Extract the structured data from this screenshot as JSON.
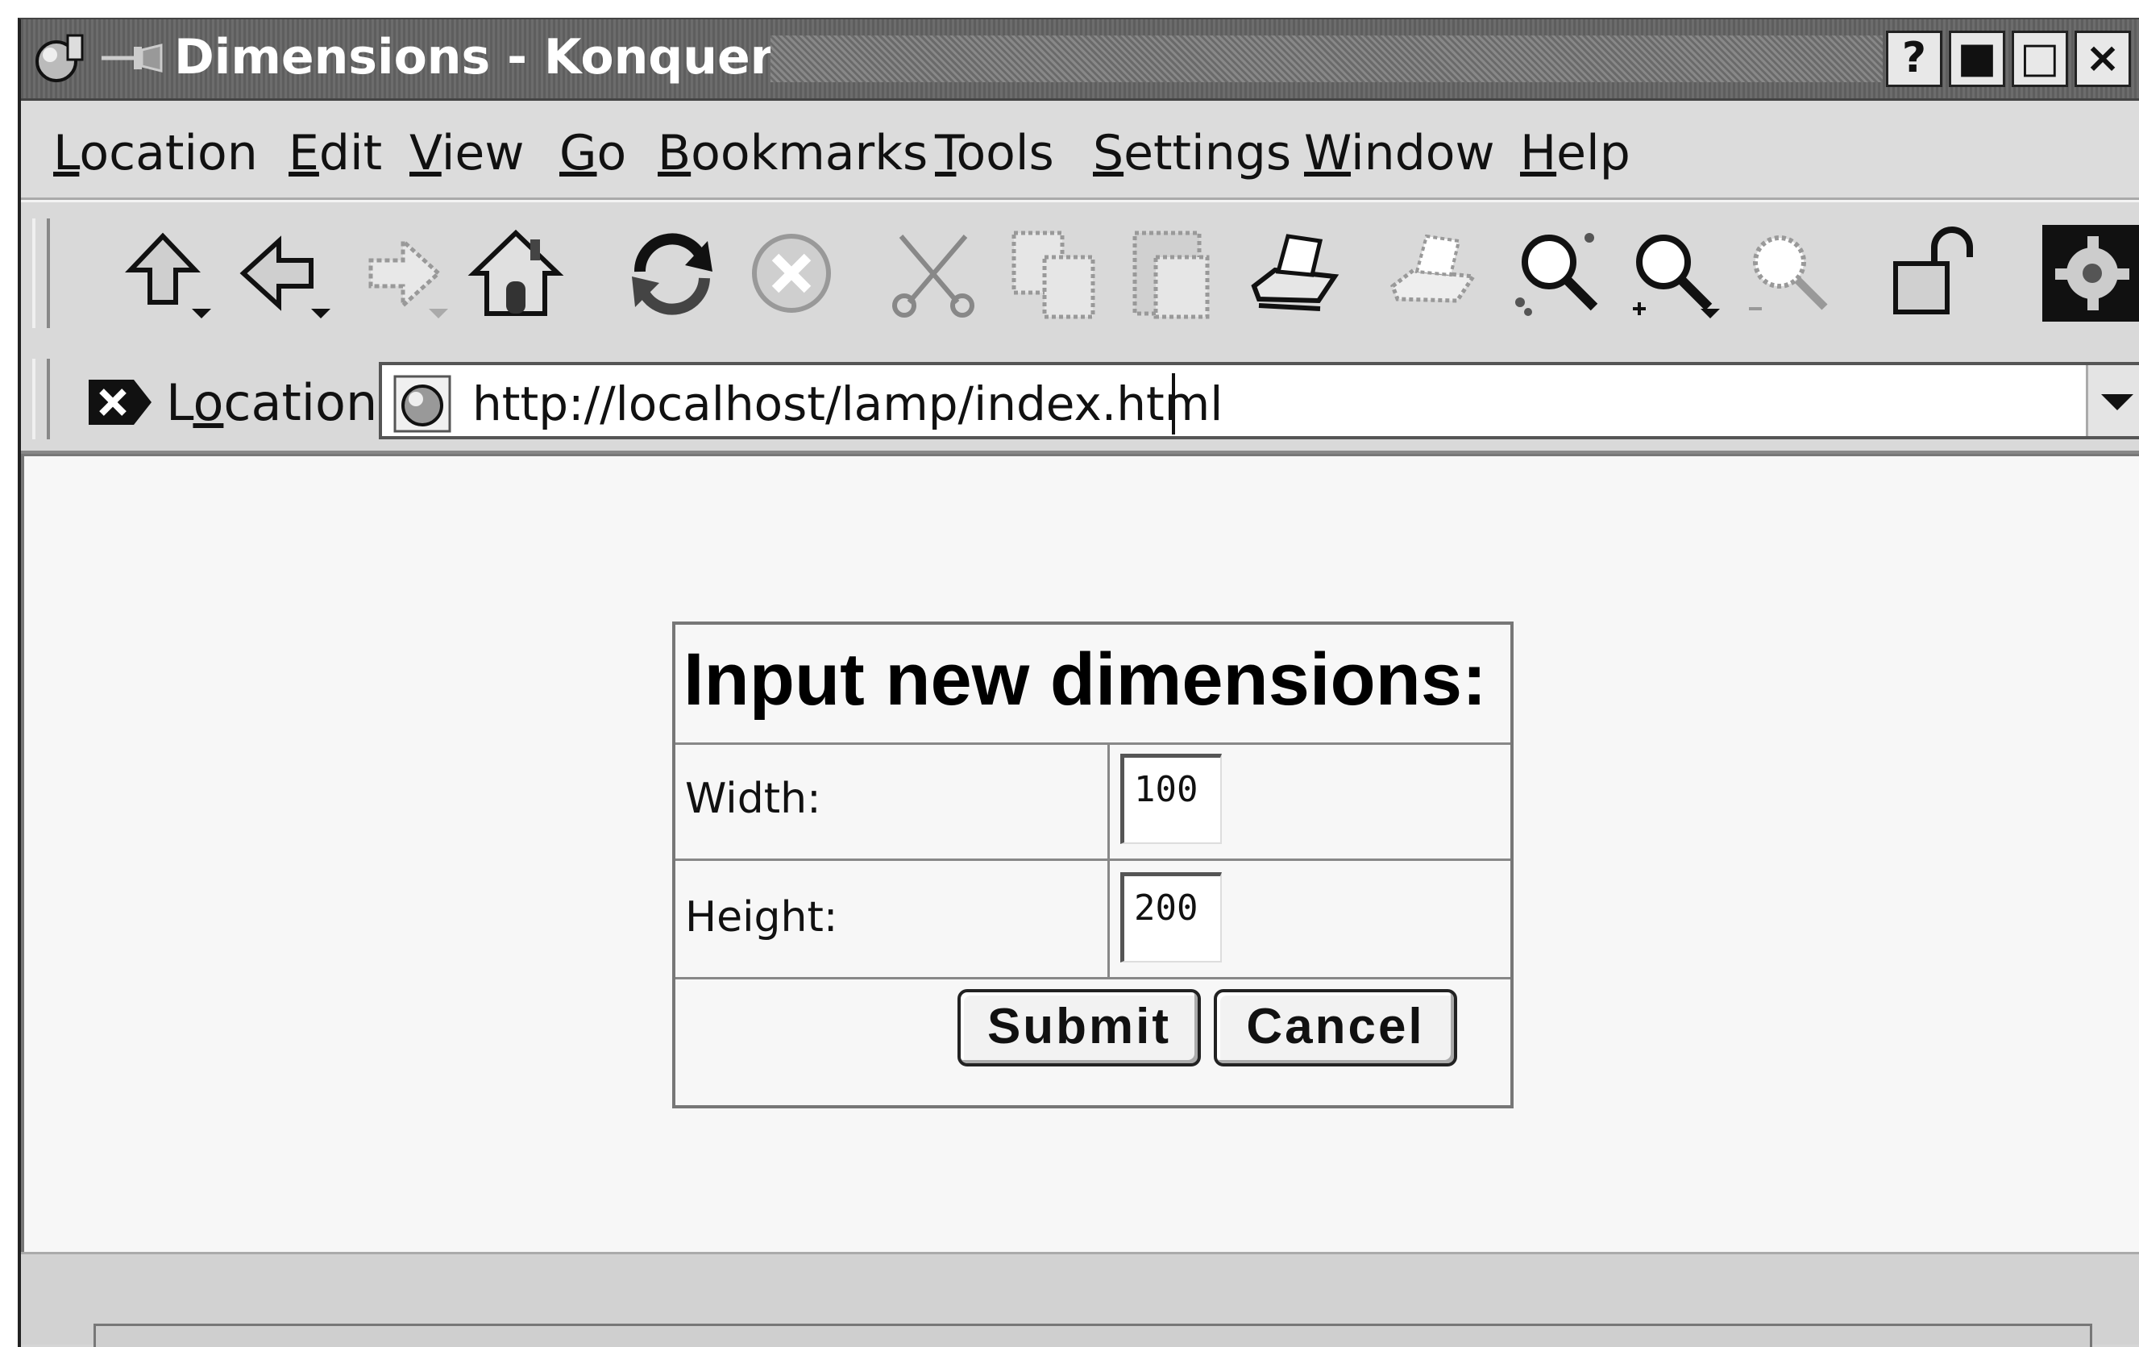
{
  "window": {
    "title": "Dimensions - Konqueror",
    "controls": [
      "?",
      "■",
      "□",
      "×"
    ]
  },
  "menubar": {
    "items": [
      {
        "first": "L",
        "rest": "ocation"
      },
      {
        "first": "E",
        "rest": "dit"
      },
      {
        "first": "V",
        "rest": "iew"
      },
      {
        "first": "G",
        "rest": "o"
      },
      {
        "first": "B",
        "rest": "ookmarks"
      },
      {
        "first": "T",
        "rest": "ools"
      },
      {
        "first": "S",
        "rest": "ettings"
      },
      {
        "first": "W",
        "rest": "indow"
      },
      {
        "first": "H",
        "rest": "elp"
      }
    ]
  },
  "toolbar": {
    "icons": [
      "up-icon",
      "back-icon",
      "forward-icon",
      "home-icon",
      "reload-icon",
      "stop-icon",
      "cut-icon",
      "copy-icon",
      "paste-icon",
      "print-icon",
      "print-preview-icon",
      "find-icon",
      "zoom-in-icon",
      "zoom-out-icon",
      "security-lock-icon",
      "konqueror-gear-icon"
    ]
  },
  "location_bar": {
    "label_pre": "L",
    "label_ul": "o",
    "label_post": "cation",
    "url": "http://localhost/lamp/index.html"
  },
  "form": {
    "heading": "Input new dimensions:",
    "rows": [
      {
        "label": "Width:",
        "value": "100"
      },
      {
        "label": "Height:",
        "value": "200"
      }
    ],
    "submit_label": "Submit",
    "cancel_label": "Cancel"
  }
}
